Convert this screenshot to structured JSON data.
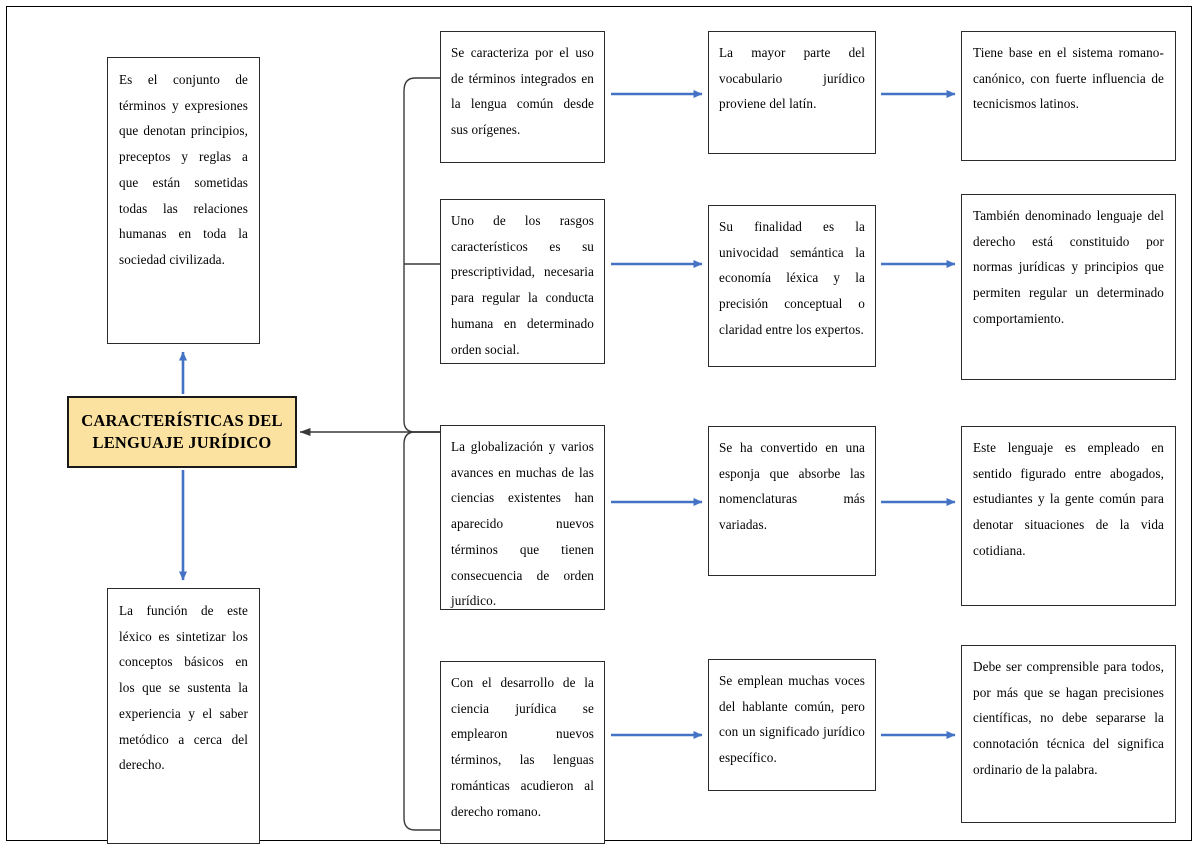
{
  "diagram": {
    "title": "CARACTERÍSTICAS DEL LENGUAJE JURÍDICO",
    "colors": {
      "center_fill": "#fbe2a0",
      "center_border": "#1a1a1a",
      "node_border": "#2b2b2b",
      "arrow_blue": "#4472c4",
      "bracket_black": "#2b2b2b",
      "page_background": "#ffffff"
    },
    "center": {
      "line1": "CARACTERÍSTICAS DEL",
      "line2": "LENGUAJE JURÍDICO"
    },
    "left_column": [
      {
        "id": "left-top",
        "text": "Es el conjunto de términos y expresiones que denotan principios, preceptos y reglas a que están sometidas todas las relaciones humanas en toda la sociedad civilizada."
      },
      {
        "id": "left-bottom",
        "text": "La función de este léxico es sintetizar los conceptos básicos en los que se sustenta la experiencia y el saber metódico a cerca del derecho."
      }
    ],
    "rows": [
      {
        "id": "row-1",
        "col1": "Se caracteriza por el uso de términos integrados en la lengua común desde sus orígenes.",
        "col2": "La mayor parte del vocabulario jurídico proviene del latín.",
        "col3": "Tiene base en el sistema romano-canónico, con fuerte influencia de tecnicismos latinos."
      },
      {
        "id": "row-2",
        "col1": "Uno de los rasgos característicos es su prescriptividad, necesaria para regular la conducta humana en determinado orden social.",
        "col2": "Su finalidad es la univocidad semántica la economía léxica y la precisión conceptual o claridad entre los expertos.",
        "col3": "También denominado lenguaje del derecho está constituido por normas jurídicas y principios que permiten regular un determinado comportamiento."
      },
      {
        "id": "row-3",
        "col1": "La globalización y varios avances en muchas de las ciencias existentes han aparecido nuevos términos que tienen consecuencia de orden jurídico.",
        "col2": "Se ha convertido en una esponja que absorbe las nomenclaturas más variadas.",
        "col3": "Este lenguaje es empleado en sentido figurado entre abogados, estudiantes y la gente común para denotar situaciones de la vida cotidiana."
      },
      {
        "id": "row-4",
        "col1": "Con el desarrollo de la ciencia jurídica se emplearon nuevos términos, las lenguas románticas acudieron al derecho romano.",
        "col2": "Se emplean muchas voces del hablante común, pero con un significado jurídico específico.",
        "col3": "Debe ser comprensible para todos, por más que se hagan precisiones científicas, no debe separarse la connotación técnica del significa ordinario de la palabra."
      }
    ]
  }
}
